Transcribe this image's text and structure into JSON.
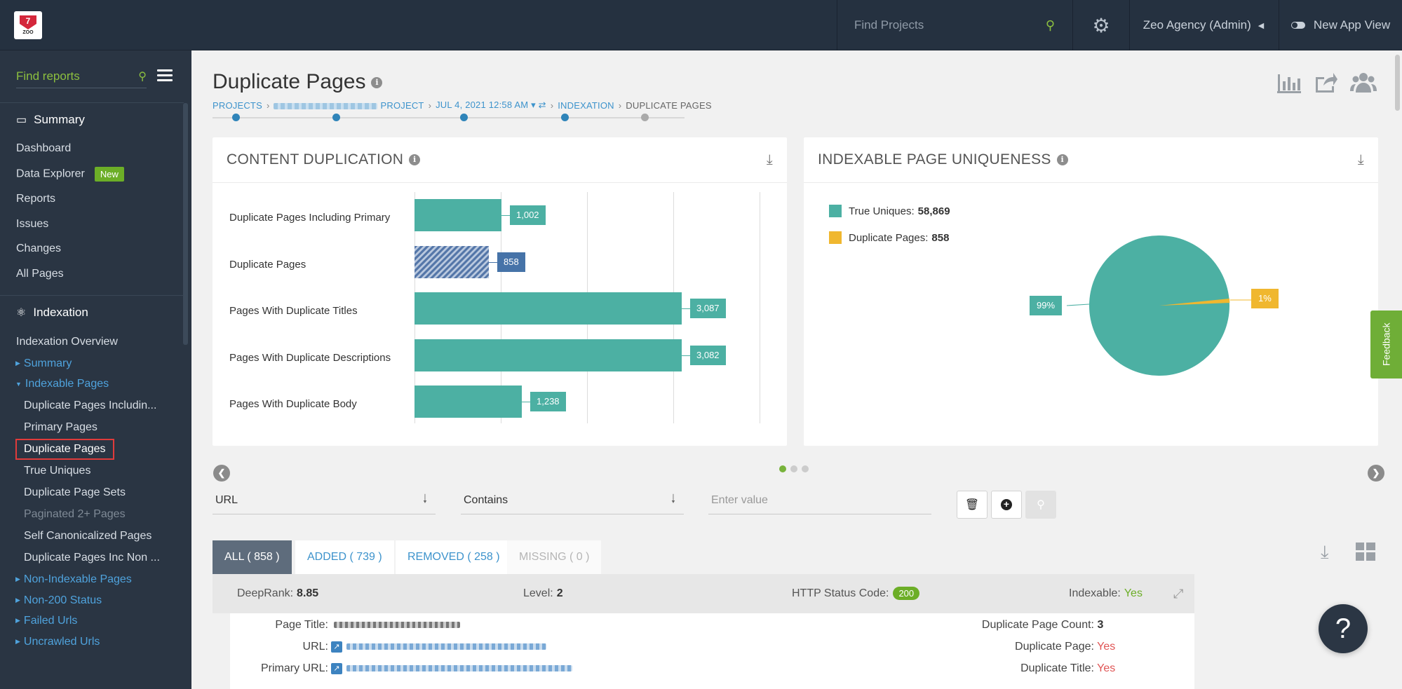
{
  "topbar": {
    "logo_text": "ZOO",
    "find_projects_placeholder": "Find Projects",
    "agency": "Zeo Agency (Admin)",
    "new_app_view": "New App View"
  },
  "sidebar": {
    "find_reports_placeholder": "Find reports",
    "summary_heading": "Summary",
    "summary_items": [
      "Dashboard",
      "Data Explorer",
      "Reports",
      "Issues",
      "Changes",
      "All Pages"
    ],
    "new_badge": "New",
    "indexation_heading": "Indexation",
    "indexation_overview": "Indexation Overview",
    "tree": {
      "summary": "Summary",
      "indexable_pages": "Indexable Pages",
      "non_indexable": "Non-Indexable Pages",
      "non_200": "Non-200 Status",
      "failed": "Failed Urls",
      "uncrawled": "Uncrawled Urls"
    },
    "sub_items": [
      "Duplicate Pages Includin...",
      "Primary Pages",
      "Duplicate Pages",
      "True Uniques",
      "Duplicate Page Sets",
      "Paginated 2+ Pages",
      "Self Canonicalized Pages",
      "Duplicate Pages Inc Non ..."
    ]
  },
  "page": {
    "title": "Duplicate Pages",
    "breadcrumbs": [
      "PROJECTS",
      "PROJECT",
      "JUL 4, 2021 12:58 AM",
      "INDEXATION",
      "DUPLICATE PAGES"
    ]
  },
  "content_duplication": {
    "title": "CONTENT DUPLICATION",
    "rows": [
      {
        "label": "Duplicate Pages Including Primary",
        "value": "1,002"
      },
      {
        "label": "Duplicate Pages",
        "value": "858"
      },
      {
        "label": "Pages With Duplicate Titles",
        "value": "3,087"
      },
      {
        "label": "Pages With Duplicate Descriptions",
        "value": "3,082"
      },
      {
        "label": "Pages With Duplicate Body",
        "value": "1,238"
      }
    ]
  },
  "uniqueness": {
    "title": "INDEXABLE PAGE UNIQUENESS",
    "legend": [
      {
        "label": "True Uniques:",
        "value": "58,869",
        "color": "#4cb0a3"
      },
      {
        "label": "Duplicate Pages:",
        "value": "858",
        "color": "#f0b72f"
      }
    ],
    "pct_true": "99%",
    "pct_dup": "1%"
  },
  "feedback": "Feedback",
  "filters": {
    "field": "URL",
    "operator": "Contains",
    "value_placeholder": "Enter value"
  },
  "tabs": [
    {
      "label": "ALL ( 858 )"
    },
    {
      "label": "ADDED ( 739 )"
    },
    {
      "label": "REMOVED ( 258 )"
    },
    {
      "label": "MISSING ( 0 )"
    }
  ],
  "row": {
    "deeprank_label": "DeepRank:",
    "deeprank": "8.85",
    "level_label": "Level:",
    "level": "2",
    "http_label": "HTTP Status Code:",
    "http": "200",
    "indexable_label": "Indexable:",
    "indexable": "Yes"
  },
  "details": {
    "page_title_label": "Page Title:",
    "url_label": "URL:",
    "primary_url_label": "Primary URL:",
    "dup_count_label": "Duplicate Page Count:",
    "dup_count": "3",
    "dup_page_label": "Duplicate Page:",
    "dup_page": "Yes",
    "dup_title_label": "Duplicate Title:",
    "dup_title": "Yes"
  },
  "help": "?"
}
